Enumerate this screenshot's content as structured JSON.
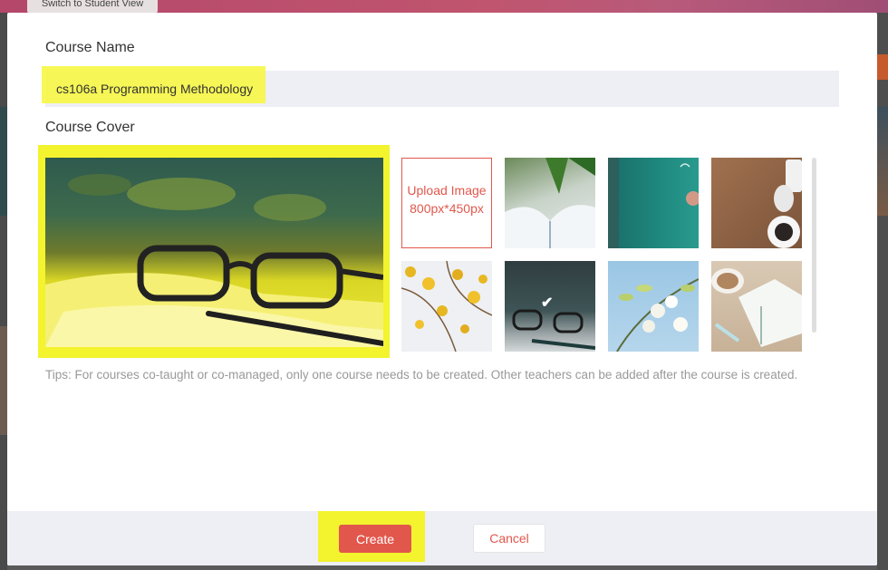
{
  "background": {
    "switch_view_label": "Switch to Student View"
  },
  "modal": {
    "course_name_label": "Course Name",
    "course_name_value": "cs106a Programming Methodology",
    "course_cover_label": "Course Cover",
    "upload": {
      "line1": "Upload Image",
      "line2": "800px*450px"
    },
    "cover_options": [
      {
        "name": "open-book-plant",
        "selected": false
      },
      {
        "name": "green-chalkboard",
        "selected": false
      },
      {
        "name": "wood-desk-coffee",
        "selected": false
      },
      {
        "name": "yellow-ginkgo-leaves",
        "selected": false
      },
      {
        "name": "glasses-pencil",
        "selected": true
      },
      {
        "name": "white-blossoms",
        "selected": false
      },
      {
        "name": "coffee-open-book",
        "selected": false
      }
    ],
    "tips": "Tips: For courses co-taught or co-managed, only one course needs to be created. Other teachers can be added after the course is created.",
    "create_label": "Create",
    "cancel_label": "Cancel"
  },
  "colors": {
    "accent": "#e2574c",
    "highlight": "#f3f32e",
    "input_bg": "#eeeef5"
  }
}
